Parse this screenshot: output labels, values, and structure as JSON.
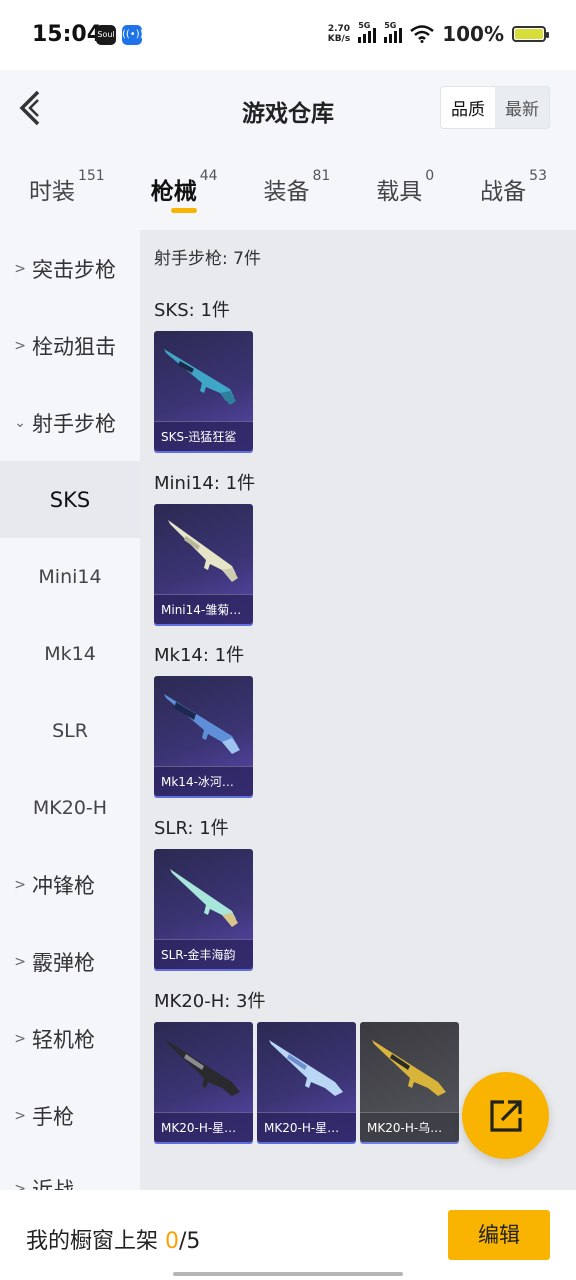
{
  "status_bar": {
    "time": "15:04",
    "net_speed_value": "2.70",
    "net_speed_unit": "KB/s",
    "signal1": "5G",
    "signal2": "5G",
    "battery": "100%"
  },
  "header": {
    "title": "游戏仓库",
    "sort_quality": "品质",
    "sort_latest": "最新"
  },
  "tabs": [
    {
      "label": "时装",
      "count": "151"
    },
    {
      "label": "枪械",
      "count": "44"
    },
    {
      "label": "装备",
      "count": "81"
    },
    {
      "label": "载具",
      "count": "0"
    },
    {
      "label": "战备",
      "count": "53"
    }
  ],
  "sidebar": {
    "assault": "突击步枪",
    "bolt": "栓动狙击",
    "marksman": "射手步枪",
    "subs": [
      "SKS",
      "Mini14",
      "Mk14",
      "SLR",
      "MK20-H"
    ],
    "smg": "冲锋枪",
    "shotgun": "霰弹枪",
    "lmg": "轻机枪",
    "pistol": "手枪",
    "melee": "近战"
  },
  "content": {
    "section": "射手步枪: 7件",
    "groups": [
      {
        "title": "SKS: 1件",
        "items": [
          "SKS-迅猛狂鲨"
        ]
      },
      {
        "title": "Mini14: 1件",
        "items": [
          "Mini14-雏菊…"
        ]
      },
      {
        "title": "Mk14: 1件",
        "items": [
          "Mk14-冰河…"
        ]
      },
      {
        "title": "SLR: 1件",
        "items": [
          "SLR-金丰海韵"
        ]
      },
      {
        "title": "MK20-H: 3件",
        "items": [
          "MK20-H-星…",
          "MK20-H-星…",
          "MK20-H-乌…"
        ]
      }
    ]
  },
  "bottom": {
    "label_prefix": "我的橱窗上架 ",
    "current": "0",
    "total": "/5",
    "edit": "编辑"
  },
  "colors": {
    "accent": "#f8b400",
    "card_purple": "#3b3474",
    "card_gray": "#4b4b52"
  },
  "icons": [
    "back-arrow-icon",
    "share-export-icon",
    "chevron-right-icon",
    "chevron-down-icon"
  ]
}
